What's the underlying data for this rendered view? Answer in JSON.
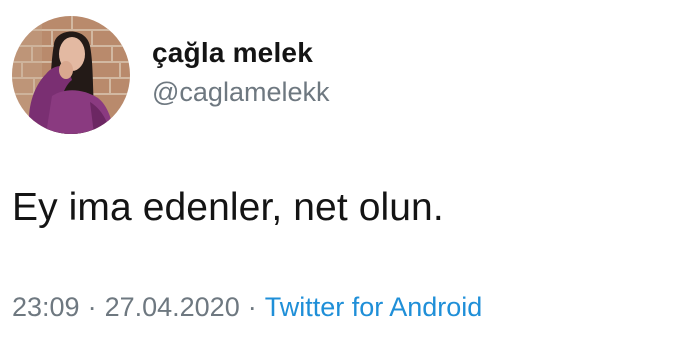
{
  "author": {
    "display_name": "çağla melek",
    "handle": "@caglamelekk"
  },
  "tweet": {
    "text": "Ey ima edenler, net olun."
  },
  "meta": {
    "time": "23:09",
    "separator": "·",
    "date": "27.04.2020",
    "source": "Twitter for Android"
  },
  "colors": {
    "text": "#141414",
    "secondary": "#6e7880",
    "link": "#1f8fd8"
  }
}
